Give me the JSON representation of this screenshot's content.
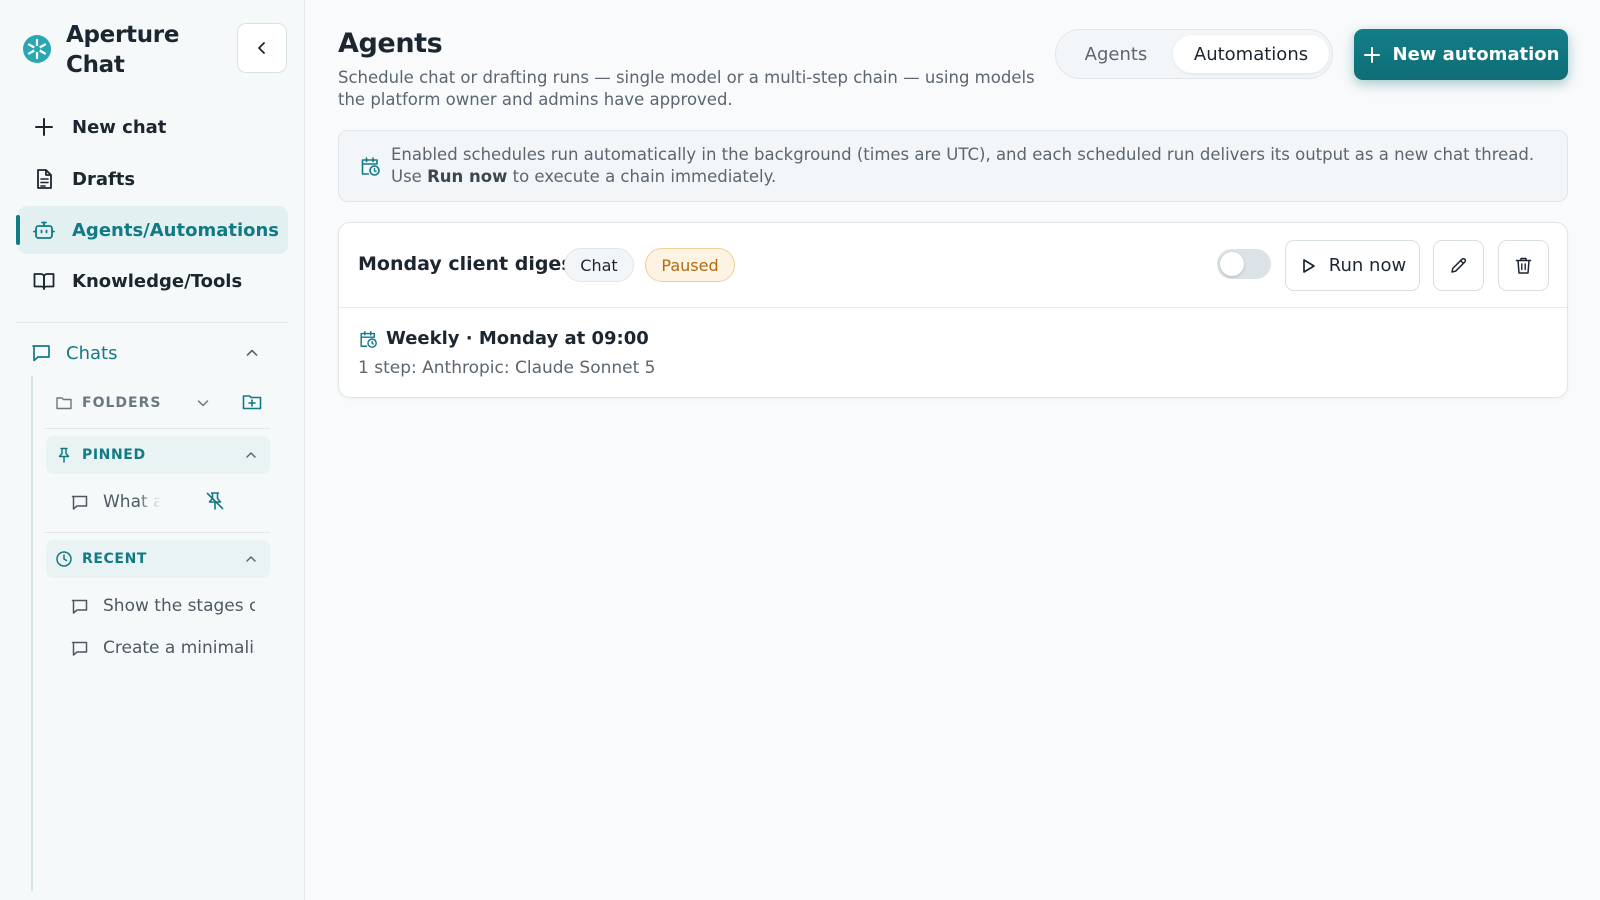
{
  "app": {
    "name": "Aperture Chat"
  },
  "sidebar": {
    "nav": [
      {
        "label": "New chat",
        "icon": "plus-icon"
      },
      {
        "label": "Drafts",
        "icon": "document-icon"
      },
      {
        "label": "Agents/Automations",
        "icon": "bot-icon",
        "active": true
      },
      {
        "label": "Knowledge/Tools",
        "icon": "book-open-icon"
      }
    ],
    "chats_label": "Chats",
    "folders_label": "FOLDERS",
    "pinned_label": "PINNED",
    "pinned_items": [
      {
        "label": "What a"
      }
    ],
    "recent_label": "RECENT",
    "recent_items": [
      {
        "label": "Show the stages c"
      },
      {
        "label": "Create a minimalis"
      }
    ]
  },
  "header": {
    "title": "Agents",
    "subtitle": "Schedule chat or drafting runs — single model or a multi-step chain — using models the platform owner and admins have approved.",
    "tabs": [
      {
        "label": "Agents"
      },
      {
        "label": "Automations",
        "selected": true
      }
    ],
    "new_button_label": "New automation"
  },
  "info": {
    "text_before": "Enabled schedules run automatically in the background (times are UTC), and each scheduled run delivers its output as a new chat thread. Use ",
    "text_bold": "Run now",
    "text_after": " to execute a chain immediately."
  },
  "automations": [
    {
      "name": "Monday client digest",
      "type_badge": "Chat",
      "status_badge": "Paused",
      "enabled": false,
      "run_now_label": "Run now",
      "schedule": "Weekly · Monday at 09:00",
      "steps": "1 step: Anthropic: Claude Sonnet 5"
    }
  ],
  "colors": {
    "accent": "#127a84",
    "accent_bg": "#e2f0f1",
    "paused_text": "#b36b10",
    "paused_bg": "#fdf3e3"
  }
}
